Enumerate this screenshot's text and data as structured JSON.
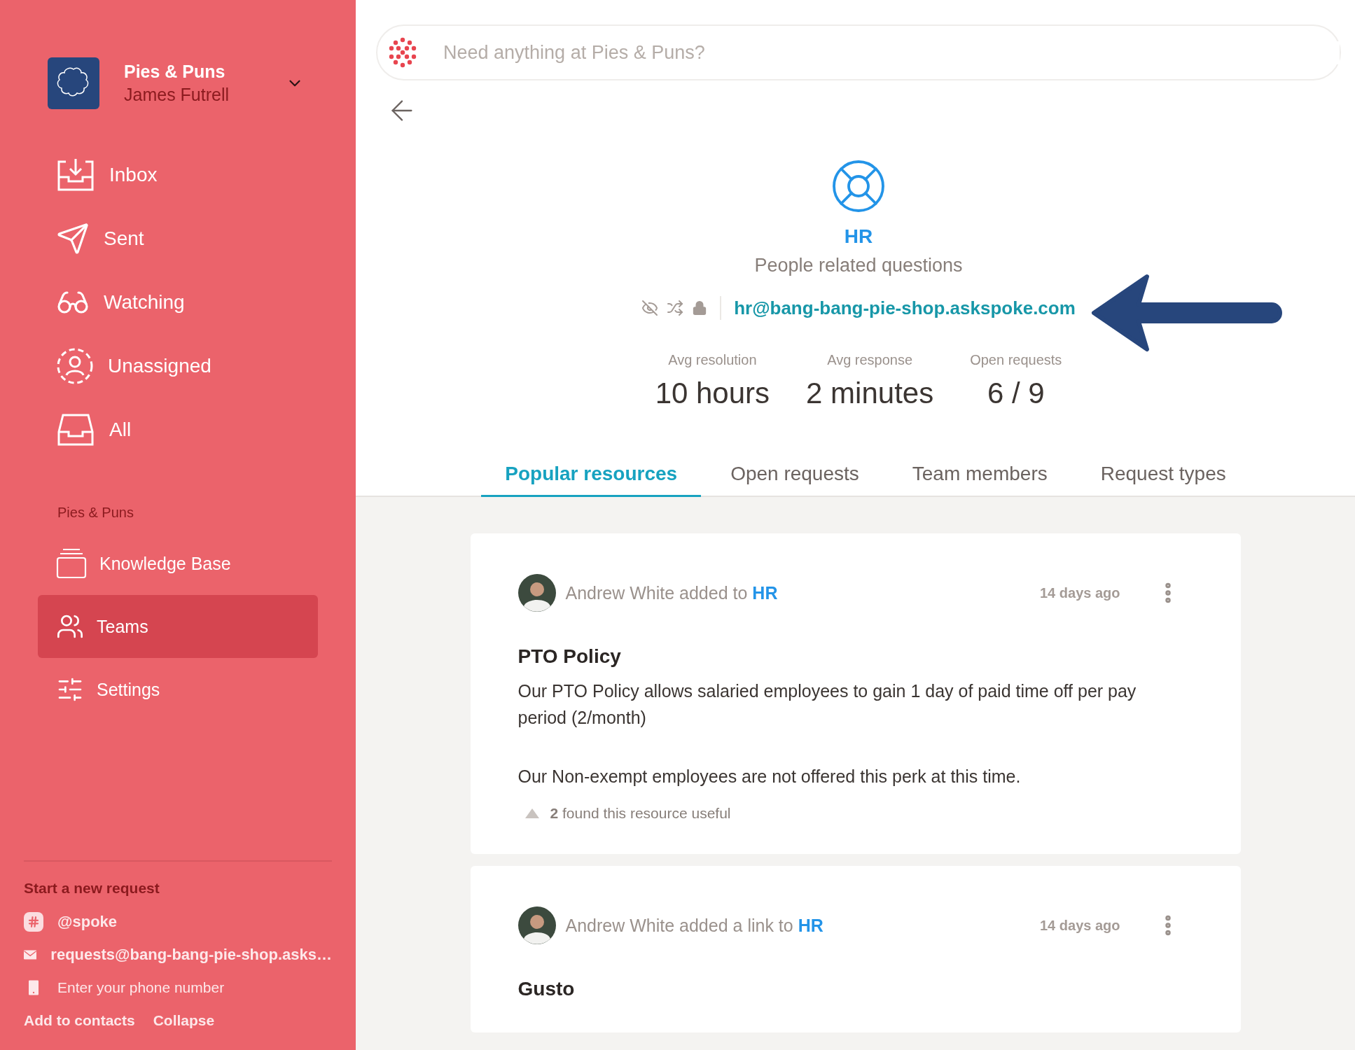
{
  "sidebar": {
    "org": {
      "name": "Pies & Puns",
      "user": "James Futrell"
    },
    "nav": [
      {
        "label": "Inbox",
        "kind": "inbox",
        "selected": false
      },
      {
        "label": "Sent",
        "kind": "sent",
        "selected": false
      },
      {
        "label": "Watching",
        "kind": "watching",
        "selected": false
      },
      {
        "label": "Unassigned",
        "kind": "unassigned",
        "selected": false
      },
      {
        "label": "All",
        "kind": "all",
        "selected": false
      }
    ],
    "section_label": "Pies & Puns",
    "section_items": [
      {
        "label": "Knowledge Base",
        "kind": "knowledge",
        "selected": false
      },
      {
        "label": "Teams",
        "kind": "teams",
        "selected": true
      },
      {
        "label": "Settings",
        "kind": "settings",
        "selected": false
      }
    ],
    "new_request": {
      "title": "Start a new request",
      "channels": [
        {
          "kind": "slack",
          "text": "@spoke"
        },
        {
          "kind": "email",
          "text": "requests@bang-bang-pie-shop.asks…"
        }
      ],
      "phone": {
        "placeholder": "Enter your phone number"
      },
      "links": [
        "Add to contacts",
        "Collapse"
      ]
    }
  },
  "search": {
    "placeholder": "Need anything at Pies & Puns?"
  },
  "team": {
    "name": "HR",
    "description": "People related questions",
    "email": "hr@bang-bang-pie-shop.askspoke.com",
    "stats": [
      {
        "label": "Avg resolution",
        "value": "10 hours"
      },
      {
        "label": "Avg response",
        "value": "2 minutes"
      },
      {
        "label": "Open requests",
        "value": "6 / 9"
      }
    ]
  },
  "tabs": [
    {
      "label": "Popular resources",
      "selected": true
    },
    {
      "label": "Open requests",
      "selected": false
    },
    {
      "label": "Team members",
      "selected": false
    },
    {
      "label": "Request types",
      "selected": false
    }
  ],
  "resources": [
    {
      "activity": "Andrew White added to",
      "team": "HR",
      "time": "14 days ago",
      "title": "PTO Policy",
      "paragraphs": [
        "Our PTO Policy allows salaried employees to gain 1 day of paid time off per pay period (2/month)",
        "Our Non-exempt employees are not offered this perk at this time."
      ],
      "useful": "**2** found this resource useful"
    },
    {
      "activity": "Andrew White added a link to",
      "team": "HR",
      "time": "14 days ago",
      "title": "Gusto"
    }
  ]
}
